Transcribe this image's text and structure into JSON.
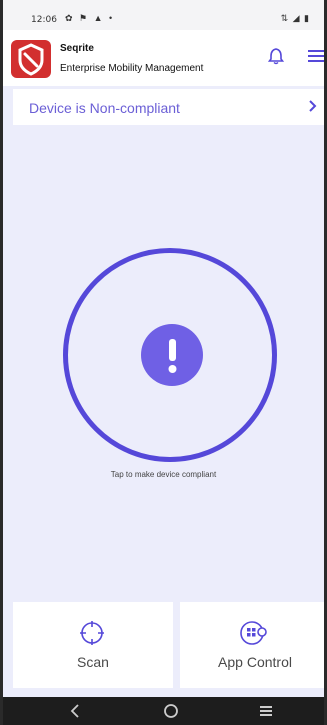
{
  "statusbar": {
    "time": "12:06",
    "left_icons": "✿ ⚑ ▲ •",
    "right_icons": "⇅ ◢ ▮"
  },
  "appbar": {
    "title": "Seqrite",
    "subtitle": "Enterprise Mobility Management",
    "icons": [
      "seqrite-logo-icon",
      "bell-icon",
      "menu-icon"
    ]
  },
  "banner": {
    "text": "Device is Non-compliant",
    "status_color": "#6b5fd6"
  },
  "compliance": {
    "hint": "Tap to make device compliant",
    "ring_color": "#5548d9",
    "icon": "exclamation-icon"
  },
  "tiles": [
    {
      "label": "Scan",
      "icon": "scan-crosshair-icon"
    },
    {
      "label": "App Control",
      "icon": "app-grid-gear-icon"
    }
  ],
  "navbar": {
    "icons": [
      "back-icon",
      "home-icon",
      "recents-icon"
    ]
  }
}
